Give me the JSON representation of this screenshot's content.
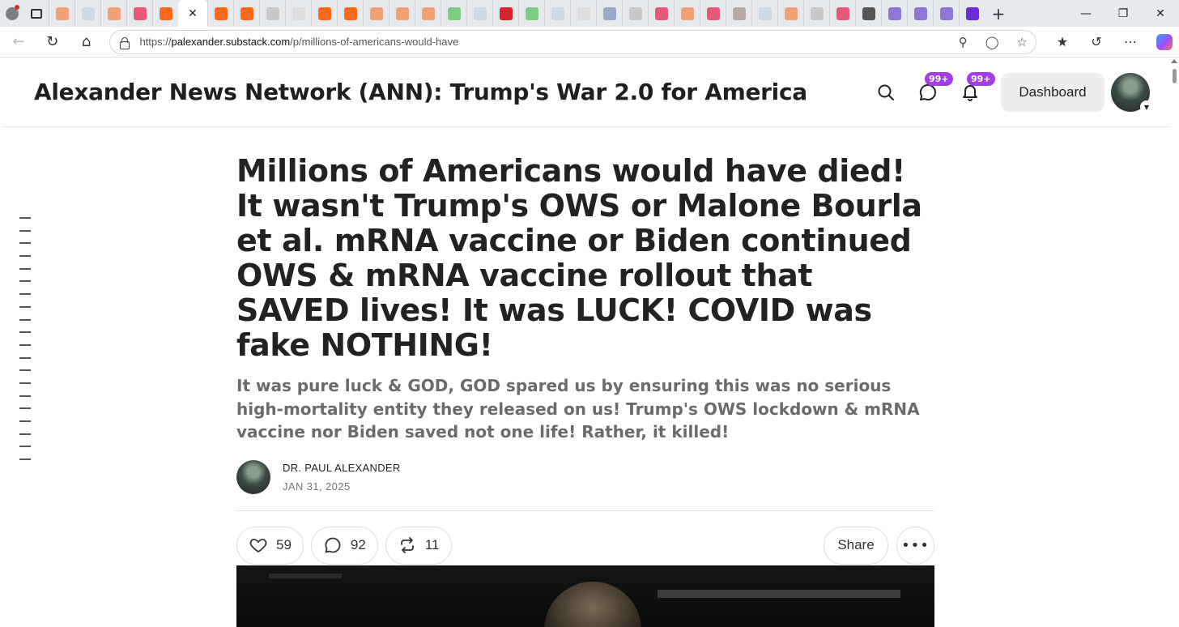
{
  "browser": {
    "url_prefix": "https://",
    "url_host": "palexander.substack.com",
    "url_path": "/p/millions-of-americans-would-have",
    "tab_favicon_colors": [
      "#f4a179",
      "#cfd8e6",
      "#f4a179",
      "#ea5a78",
      "#ff6719",
      "#ff6719",
      "#ff6719",
      "#c8c8c8",
      "#dcdcdc",
      "#ff6719",
      "#ff6719",
      "#f4a179",
      "#f4a179",
      "#f4a179",
      "#7ccc84",
      "#cfd8e6",
      "#d9232e",
      "#7ccc84",
      "#cfd8e6",
      "#dcdcdc",
      "#9aa9c9",
      "#c8c8c8",
      "#ea5a78",
      "#f4a179",
      "#ea5a78",
      "#b8aaa0",
      "#cfd8e6",
      "#f4a179",
      "#c8c8c8",
      "#ea5a78",
      "#555555",
      "#8f77d8",
      "#8f77d8",
      "#8f77d8",
      "#6a2bd8"
    ]
  },
  "header": {
    "site_title": "Alexander News Network (ANN): Trump's War 2.0 for America",
    "chat_badge": "99+",
    "notif_badge": "99+",
    "dashboard_label": "Dashboard"
  },
  "post": {
    "title": "Millions of Americans would have died! It wasn't Trump's OWS or Malone Bourla et al. mRNA vaccine or Biden continued OWS & mRNA vaccine rollout that SAVED lives! It was LUCK! COVID was fake NOTHING!",
    "subtitle": "It was pure luck & GOD, GOD spared us by ensuring this was no serious high-mortality entity they released on us! Trump's OWS lockdown & mRNA vaccine nor Biden saved not one life! Rather, it killed!",
    "author": "DR. PAUL ALEXANDER",
    "date": "JAN 31, 2025",
    "likes": "59",
    "comments": "92",
    "restacks": "11",
    "share_label": "Share"
  },
  "toc": {
    "dash_count": 20
  }
}
